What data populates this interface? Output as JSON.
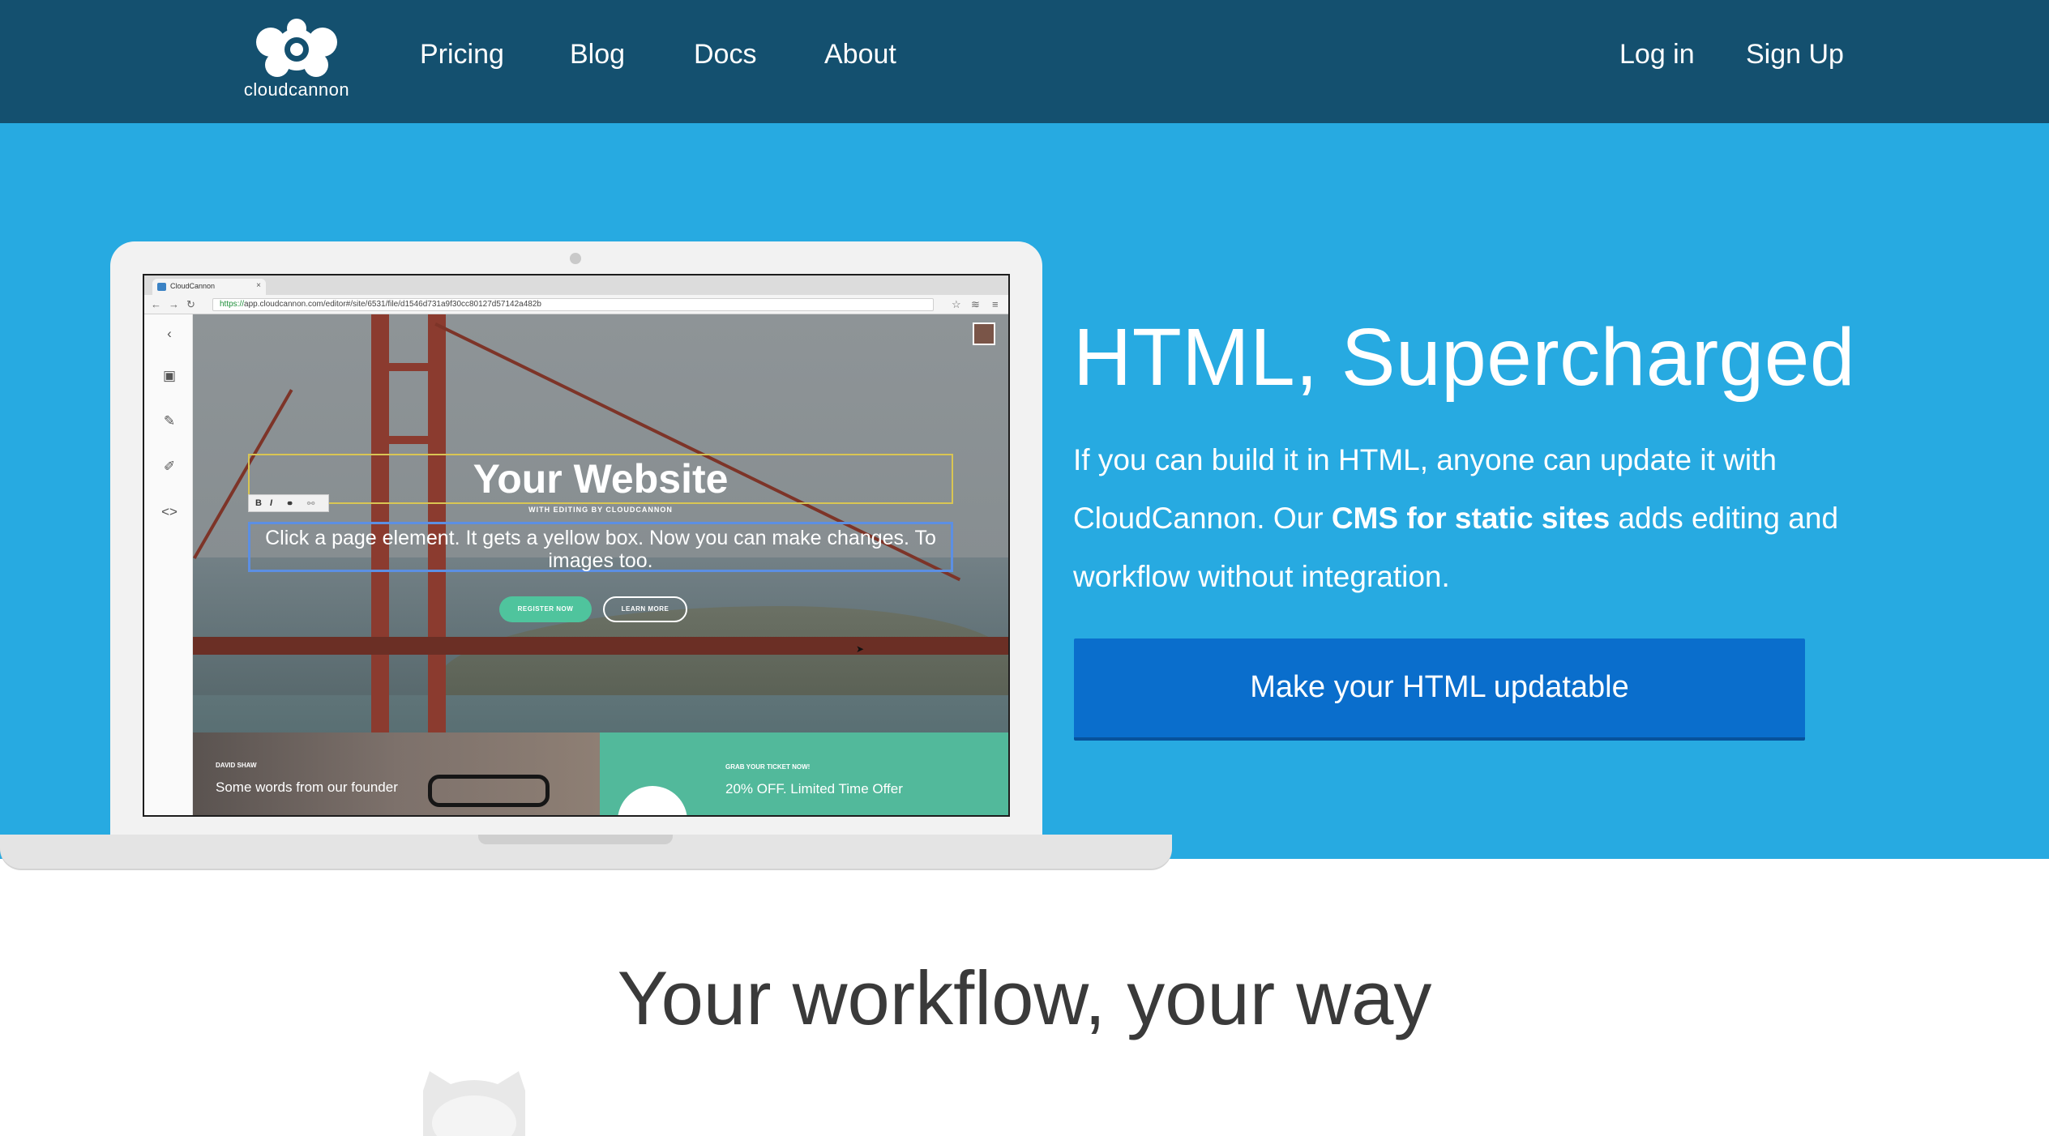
{
  "nav": {
    "logo_text": "cloudcannon",
    "links": [
      "Pricing",
      "Blog",
      "Docs",
      "About"
    ],
    "login": "Log in",
    "signup": "Sign Up"
  },
  "colors": {
    "nav_bg": "#14506f",
    "hero_bg": "#27aae1",
    "cta_bg": "#0a6ecc",
    "register_btn": "#4fc49d",
    "ticket_bg": "#52b99b"
  },
  "mockup": {
    "tab_label": "CloudCannon",
    "url_scheme": "https://",
    "url_rest": "app.cloudcannon.com/editor#/site/6531/file/d1546d731a9f30cc80127d57142a482b",
    "site_title": "Your Website",
    "site_subtitle": "WITH EDITING BY CLOUDCANNON",
    "toolbar": [
      "B",
      "I"
    ],
    "site_paragraph": "Click a page element. It gets a yellow box. Now you can make changes. To images too.",
    "register_label": "REGISTER NOW",
    "learn_label": "LEARN MORE",
    "founder_name": "DAVID SHAW",
    "founder_words": "Some words from our founder",
    "ticket_small": "GRAB YOUR TICKET NOW!",
    "ticket_offer": "20% OFF. Limited Time Offer"
  },
  "hero": {
    "title": "HTML, Supercharged",
    "copy_before": "If you can build it in HTML, anyone can update it with CloudCannon. Our ",
    "copy_bold": "CMS for static sites",
    "copy_after": " adds editing and workflow without integration.",
    "cta": "Make your HTML updatable"
  },
  "section": {
    "title": "Your workflow, your way"
  },
  "icons": [
    "cloudcannon-logo-icon",
    "back-arrow-icon",
    "forward-arrow-icon",
    "reload-icon",
    "save-icon",
    "brush-icon",
    "pencil-icon",
    "code-icon",
    "github-octocat-icon"
  ]
}
